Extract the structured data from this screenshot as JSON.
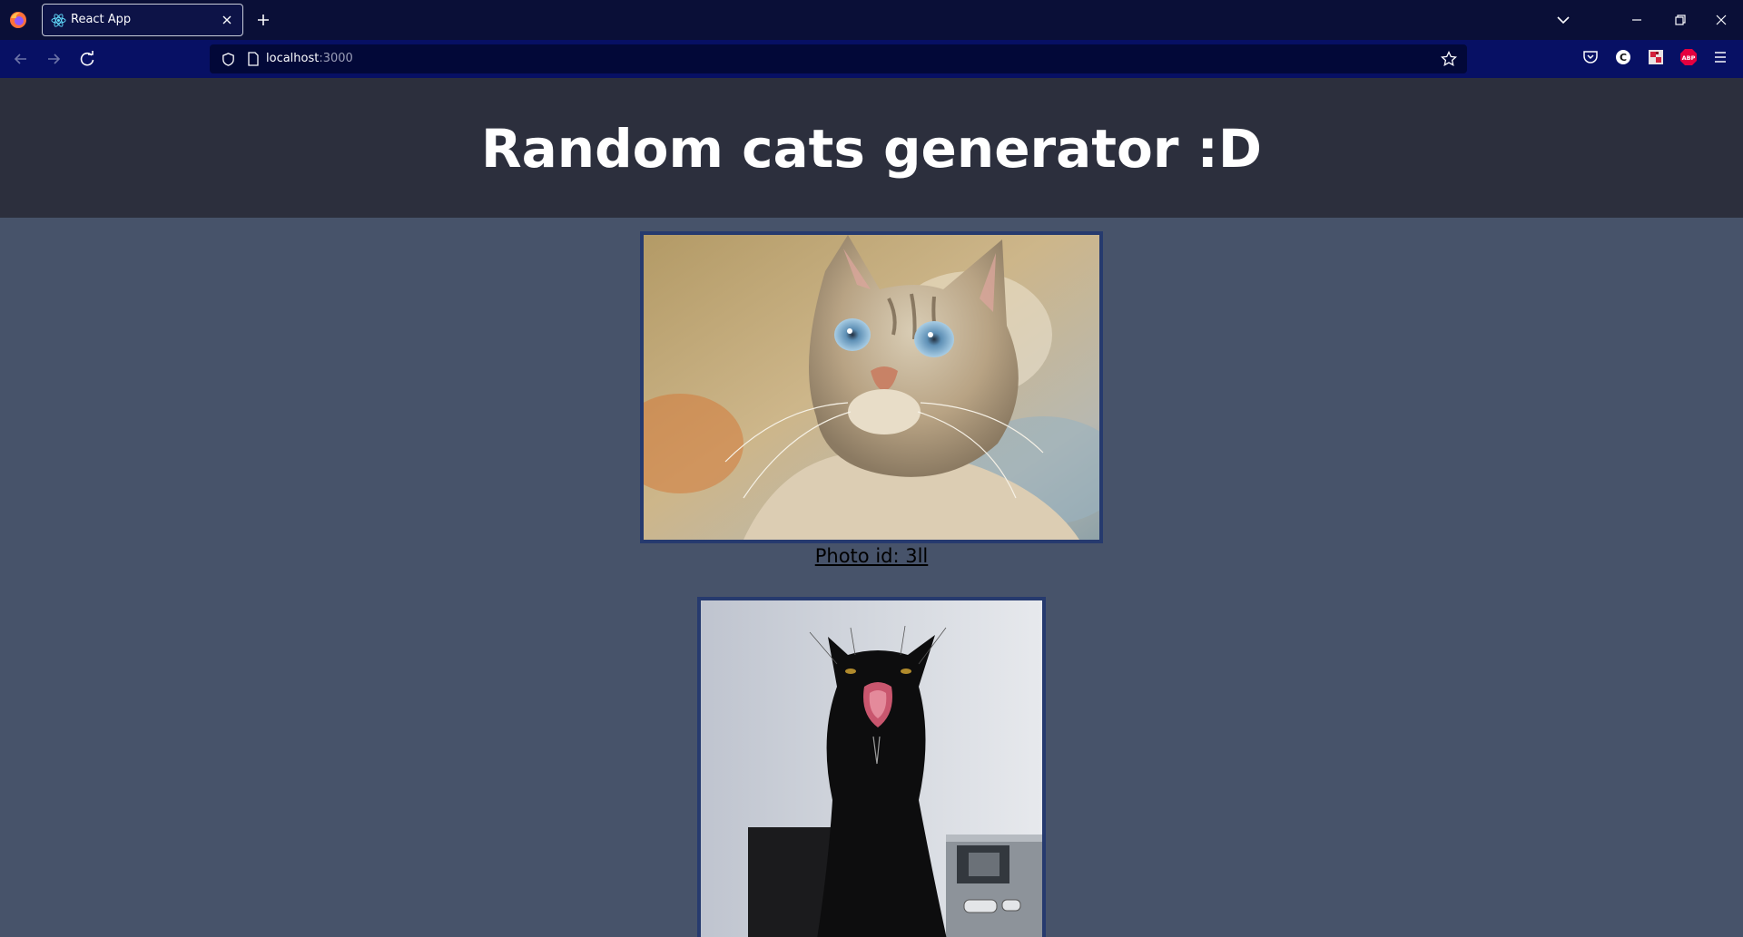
{
  "browser": {
    "tab_title": "React App",
    "url_host": "localhost",
    "url_port": ":3000"
  },
  "page": {
    "title": "Random cats generator :D",
    "photos": [
      {
        "caption": "Photo id: 3ll",
        "alt": "cat looking up"
      },
      {
        "caption": "",
        "alt": "black cat yawning"
      }
    ]
  },
  "icons": {
    "browser": "firefox-icon",
    "favicon": "react-icon",
    "extensions": [
      "pocket-icon",
      "c-extension-icon",
      "pixel-extension-icon",
      "adblock-icon",
      "menu-icon"
    ]
  },
  "colors": {
    "tab_bar": "#0a0f37",
    "nav_bar": "#071064",
    "header": "#2c2f3d",
    "body": "#47536a",
    "frame": "#263a6e"
  }
}
